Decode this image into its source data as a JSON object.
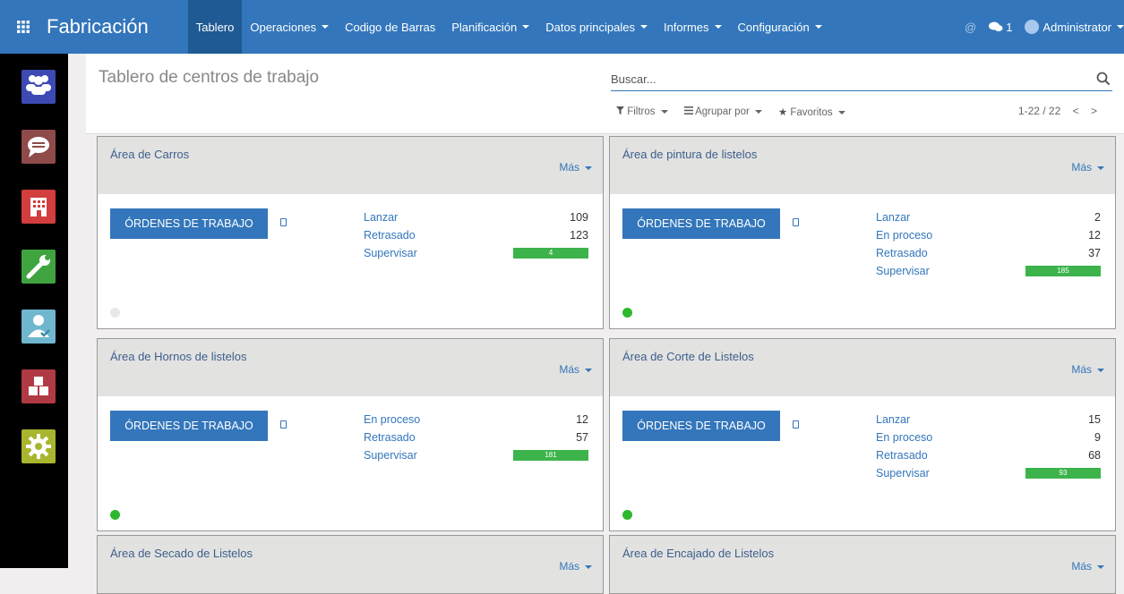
{
  "header": {
    "app_title": "Fabricación",
    "menu": [
      {
        "label": "Tablero",
        "active": true,
        "dropdown": false
      },
      {
        "label": "Operaciones",
        "dropdown": true
      },
      {
        "label": "Codigo de Barras",
        "dropdown": false
      },
      {
        "label": "Planificación",
        "dropdown": true
      },
      {
        "label": "Datos principales",
        "dropdown": true
      },
      {
        "label": "Informes",
        "dropdown": true
      },
      {
        "label": "Configuración",
        "dropdown": true
      }
    ],
    "at_icon": "@",
    "chat_count": "1",
    "user_name": "Administrator"
  },
  "sidebar": {
    "apps": [
      {
        "icon": "users-icon",
        "color": "#3d4ab3"
      },
      {
        "icon": "chat-icon",
        "color": "#8f4a4a"
      },
      {
        "icon": "building-icon",
        "color": "#d23d3d"
      },
      {
        "icon": "wrench-icon",
        "color": "#3fa43f"
      },
      {
        "icon": "user-check-icon",
        "color": "#6fb6ce"
      },
      {
        "icon": "boxes-icon",
        "color": "#b03a43"
      },
      {
        "icon": "gear-icon",
        "color": "#a9b52f"
      }
    ]
  },
  "control_panel": {
    "title": "Tablero de centros de trabajo",
    "search_placeholder": "Buscar...",
    "filters_label": "Filtros",
    "group_by_label": "Agrupar por",
    "favorites_label": "Favoritos",
    "pager": "1-22 / 22"
  },
  "cards": [
    {
      "title": "Área de Carros",
      "more": "Más",
      "button": "ÓRDENES DE TRABAJO",
      "stats": [
        {
          "label": "Lanzar",
          "value": "109"
        },
        {
          "label": "Retrasado",
          "value": "123"
        },
        {
          "label": "Supervisar",
          "value": "4",
          "bar": true
        }
      ],
      "status_color": "#e8e8e8"
    },
    {
      "title": "Área de pintura de listelos",
      "more": "Más",
      "button": "ÓRDENES DE TRABAJO",
      "stats": [
        {
          "label": "Lanzar",
          "value": "2"
        },
        {
          "label": "En proceso",
          "value": "12"
        },
        {
          "label": "Retrasado",
          "value": "37"
        },
        {
          "label": "Supervisar",
          "value": "185",
          "bar": true
        }
      ],
      "status_color": "#2eb82e"
    },
    {
      "title": "Área de Hornos de listelos",
      "more": "Más",
      "button": "ÓRDENES DE TRABAJO",
      "stats": [
        {
          "label": "En proceso",
          "value": "12"
        },
        {
          "label": "Retrasado",
          "value": "57"
        },
        {
          "label": "Supervisar",
          "value": "181",
          "bar": true
        }
      ],
      "status_color": "#2eb82e"
    },
    {
      "title": "Área de Corte de Listelos",
      "more": "Más",
      "button": "ÓRDENES DE TRABAJO",
      "stats": [
        {
          "label": "Lanzar",
          "value": "15"
        },
        {
          "label": "En proceso",
          "value": "9"
        },
        {
          "label": "Retrasado",
          "value": "68"
        },
        {
          "label": "Supervisar",
          "value": "93",
          "bar": true
        }
      ],
      "status_color": "#2eb82e"
    },
    {
      "title": "Área de Secado de Listelos",
      "more": "Más",
      "stats": []
    },
    {
      "title": "Área de Encajado de Listelos",
      "more": "Más",
      "stats": []
    }
  ]
}
